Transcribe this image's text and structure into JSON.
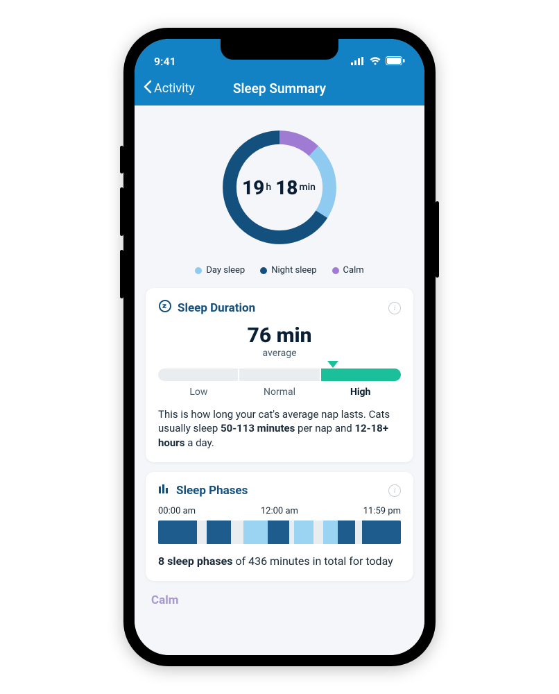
{
  "status_bar": {
    "time": "9:41"
  },
  "nav": {
    "back_label": "Activity",
    "title": "Sleep Summary"
  },
  "ring": {
    "hours": "19",
    "hours_unit": "h",
    "minutes": "18",
    "minutes_unit": "min",
    "segments": [
      {
        "name": "night",
        "color": "#14507e",
        "fraction": 0.66
      },
      {
        "name": "day",
        "color": "#8fcaf0",
        "fraction": 0.22
      },
      {
        "name": "calm",
        "color": "#9f7bd3",
        "fraction": 0.12
      }
    ]
  },
  "legend": {
    "items": [
      {
        "label": "Day sleep",
        "color": "#8fcaf0"
      },
      {
        "label": "Night sleep",
        "color": "#14507e"
      },
      {
        "label": "Calm",
        "color": "#9f7bd3"
      }
    ]
  },
  "duration_card": {
    "title": "Sleep Duration",
    "value": "76 min",
    "value_sub": "average",
    "slider": {
      "labels": [
        "Low",
        "Normal",
        "High"
      ],
      "active_index": 2,
      "marker_percent": 72
    },
    "desc_pre": "This is how long your cat's average nap lasts. Cats usually sleep ",
    "desc_b1": "50-113 minutes",
    "desc_mid": " per nap and ",
    "desc_b2": "12-18+ hours",
    "desc_post": " a day."
  },
  "phases_card": {
    "title": "Sleep Phases",
    "times": [
      "00:00 am",
      "12:00 am",
      "11:59 pm"
    ],
    "bar": [
      {
        "cls": "p-dark",
        "w": 16
      },
      {
        "cls": "p-gap",
        "w": 4
      },
      {
        "cls": "p-dark",
        "w": 10
      },
      {
        "cls": "p-gap",
        "w": 5
      },
      {
        "cls": "p-light",
        "w": 10
      },
      {
        "cls": "p-dark",
        "w": 9
      },
      {
        "cls": "p-gap",
        "w": 2
      },
      {
        "cls": "p-light",
        "w": 8
      },
      {
        "cls": "p-gap",
        "w": 4
      },
      {
        "cls": "p-light",
        "w": 6
      },
      {
        "cls": "p-dark",
        "w": 7
      },
      {
        "cls": "p-gap",
        "w": 3
      },
      {
        "cls": "p-dark",
        "w": 16
      }
    ],
    "summary_b": "8 sleep phases",
    "summary_rest": " of 436 minutes in total for today"
  },
  "calm_peek": {
    "label": "Calm"
  },
  "chart_data": {
    "type": "pie",
    "title": "Sleep Summary ring — total 19 h 18 min",
    "series": [
      {
        "name": "Night sleep",
        "fraction": 0.66,
        "color": "#14507e"
      },
      {
        "name": "Day sleep",
        "fraction": 0.22,
        "color": "#8fcaf0"
      },
      {
        "name": "Calm",
        "fraction": 0.12,
        "color": "#9f7bd3"
      }
    ]
  }
}
